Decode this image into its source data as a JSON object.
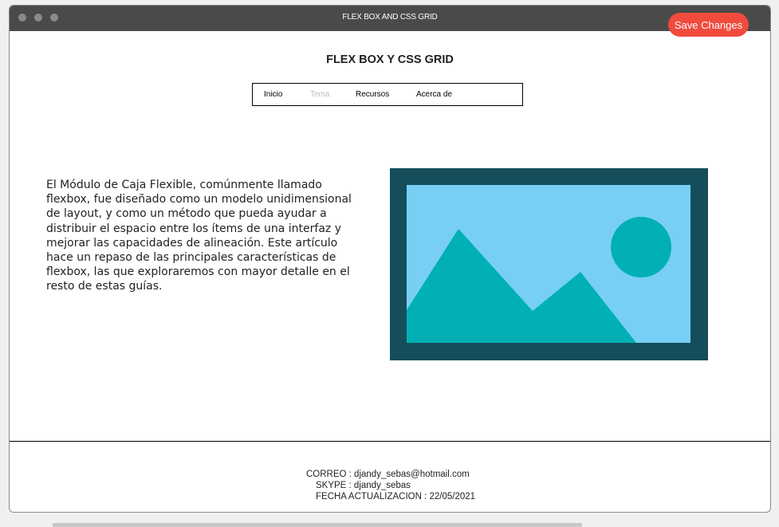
{
  "window": {
    "title": "FLEX BOX AND CSS GRID"
  },
  "toolbar": {
    "save_label": "Save Changes"
  },
  "header": {
    "title": "FLEX BOX Y CSS GRID"
  },
  "nav": {
    "items": [
      {
        "label": "Inicio"
      },
      {
        "label": "Tema"
      },
      {
        "label": "Recursos"
      },
      {
        "label": "Acerca de"
      }
    ]
  },
  "main": {
    "paragraph": "El Módulo de Caja Flexible, comúnmente llamado flexbox, fue diseñado como un modelo unidimensional de layout, y como un método que pueda ayudar a distribuir el espacio entre los ítems de una interfaz y mejorar las capacidades de alineación. Este artículo hace un repaso de las principales características de flexbox, las que exploraremos con mayor detalle en el resto de estas guías.",
    "image_icon": "image-placeholder-icon"
  },
  "footer": {
    "email_line": "CORREO : djandy_sebas@hotmail.com",
    "skype_line": "SKYPE : djandy_sebas",
    "date_line": "FECHA ACTUALIZACION : 22/05/2021"
  },
  "colors": {
    "titlebar": "#4a4a4a",
    "accent_button": "#f04b3d",
    "image_frame": "#154e5a",
    "image_sky": "#78cff5",
    "image_shapes": "#00b0b5",
    "nav_inactive": "#bdbdbd"
  }
}
